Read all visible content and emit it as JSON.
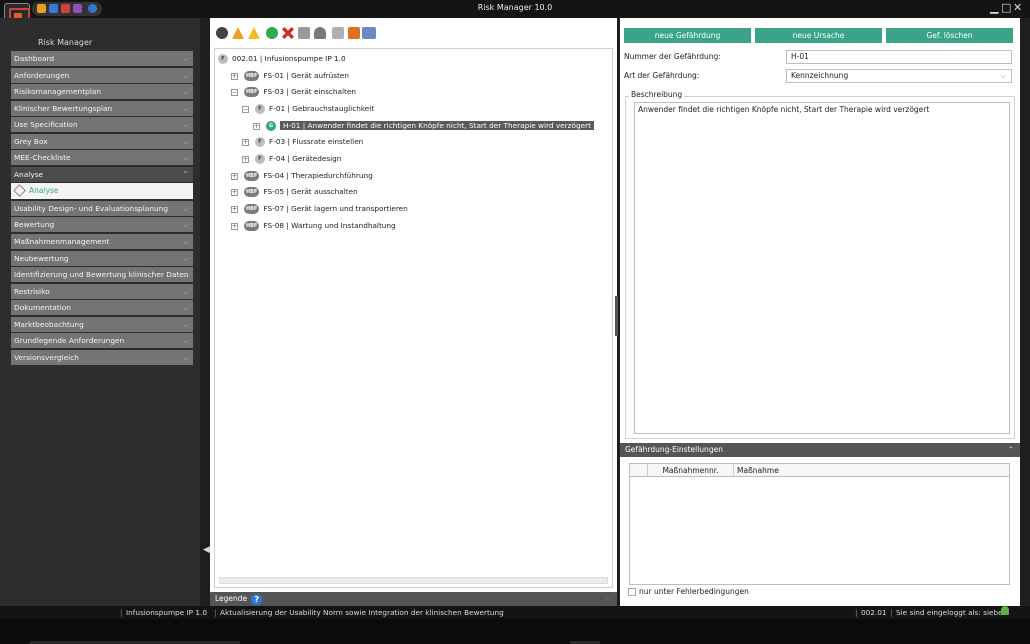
{
  "window": {
    "title": "Risk Manager  10.0",
    "app_name": "Risk Manager"
  },
  "sidebar": {
    "items": [
      {
        "label": "Dashboard"
      },
      {
        "label": "Anforderungen"
      },
      {
        "label": "Risikomanagementplan"
      },
      {
        "label": "Klinischer Bewertungsplan"
      },
      {
        "label": "Use Specification"
      },
      {
        "label": "Grey Box"
      },
      {
        "label": "MEE-Checkliste"
      },
      {
        "label": "Analyse",
        "expanded": true
      },
      {
        "label": "Usability Design- und Evaluationsplanung"
      },
      {
        "label": "Bewertung"
      },
      {
        "label": "Maßnahmenmanagement"
      },
      {
        "label": "Neubewertung"
      },
      {
        "label": "Identifizierung und Bewertung klinischer Daten"
      },
      {
        "label": "Restrisiko"
      },
      {
        "label": "Dokumentation"
      },
      {
        "label": "Marktbeobachtung"
      },
      {
        "label": "Grundlegende Anforderungen"
      },
      {
        "label": "Versionsvergleich"
      }
    ],
    "subitem": {
      "label": "Analyse"
    }
  },
  "toolbar": {
    "icons": [
      "glasses-icon",
      "warning-orange-icon",
      "warning-yellow-icon",
      "add-icon",
      "delete-icon",
      "copy-icon",
      "cut-icon",
      "paste-icon",
      "chart-icon",
      "table-icon"
    ]
  },
  "tree": {
    "nodes": [
      {
        "badge": "F",
        "id": "002.01",
        "title": "Infusionspumpe IP 1.0"
      },
      {
        "badge": "HBF",
        "id": "FS-01",
        "title": "Gerät aufrüsten"
      },
      {
        "badge": "HBF",
        "id": "FS-03",
        "title": "Gerät einschalten"
      },
      {
        "badge": "F",
        "id": "F-01",
        "title": "Gebrauchstauglichkeit"
      },
      {
        "badge": "G",
        "id": "H-01",
        "title": "Anwender findet die richtigen Knöpfe nicht, Start der Therapie wird verzögert",
        "selected": true
      },
      {
        "badge": "F",
        "id": "F-03",
        "title": "Flussrate einstellen"
      },
      {
        "badge": "F",
        "id": "F-04",
        "title": "Gerätedesign"
      },
      {
        "badge": "HBF",
        "id": "FS-04",
        "title": "Therapiedurchführung"
      },
      {
        "badge": "HBF",
        "id": "FS-05",
        "title": "Gerät ausschalten"
      },
      {
        "badge": "HBF",
        "id": "FS-07",
        "title": "Gerät lagern und transportieren"
      },
      {
        "badge": "HBF",
        "id": "FS-08",
        "title": "Wartung und Instandhaltung"
      }
    ],
    "separator": "|",
    "expander_collapsed": "+",
    "expander_expanded": "−"
  },
  "legend": {
    "label": "Legende",
    "help": "?"
  },
  "details": {
    "buttons": {
      "new_hazard": "neue Gefährdung",
      "new_cause": "neue Ursache",
      "delete_hazard": "Gef. löschen"
    },
    "number_label": "Nummer der Gefährdung:",
    "number_value": "H-01",
    "type_label": "Art der Gefährdung:",
    "type_value": "Kennzeichnung",
    "description_label": "Beschreibung",
    "description_value": "Anwender findet die richtigen Knöpfe nicht, Start der Therapie wird verzögert",
    "settings_title": "Gefährdung-Einstellungen",
    "grid_columns": [
      "Maßnahmennr.",
      "Maßnahme"
    ],
    "checkbox_label": "nur unter Fehlerbedingungen"
  },
  "statusbar": {
    "project": "Infusionspumpe IP 1.0",
    "message": "Aktualisierung der Usability Norm sowie Integration der klinischen Bewertung",
    "version": "002.01",
    "login": "Sie sind eingeloggt als: sieber"
  },
  "colors": {
    "accent": "#3aa38a",
    "nav": "#747474",
    "dark": "#141414"
  },
  "glyphs": {
    "chevron_down": "⌵",
    "chevron_up": "⌃",
    "min": "▁",
    "max": "□",
    "close": "✕",
    "arrow_left": "◀"
  }
}
